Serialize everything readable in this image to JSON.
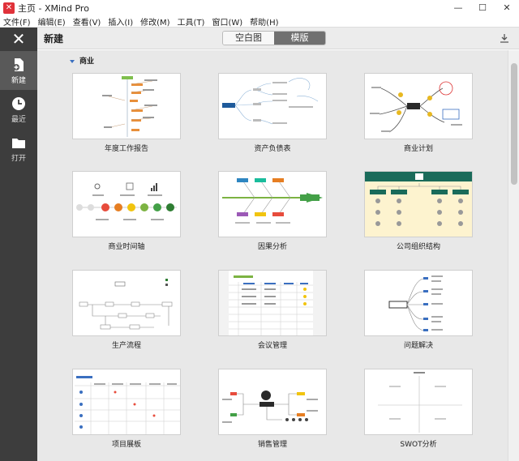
{
  "window": {
    "title": "主页 - XMind Pro",
    "minimize": "—",
    "maximize": "☐",
    "close": "✕"
  },
  "menu": [
    "文件(F)",
    "编辑(E)",
    "查看(V)",
    "插入(I)",
    "修改(M)",
    "工具(T)",
    "窗口(W)",
    "帮助(H)"
  ],
  "sidebar": {
    "items": [
      {
        "label": "新建",
        "icon": "new-file-icon"
      },
      {
        "label": "最近",
        "icon": "clock-icon"
      },
      {
        "label": "打开",
        "icon": "folder-icon"
      }
    ]
  },
  "toolbar": {
    "title": "新建",
    "tabs": [
      "空白图",
      "模版"
    ],
    "active_tab": "模版"
  },
  "section": {
    "title": "商业"
  },
  "templates": [
    {
      "label": "年度工作报告"
    },
    {
      "label": "资产负债表"
    },
    {
      "label": "商业计划"
    },
    {
      "label": "商业时间轴"
    },
    {
      "label": "因果分析"
    },
    {
      "label": "公司组织结构"
    },
    {
      "label": "生产流程"
    },
    {
      "label": "会议管理"
    },
    {
      "label": "问题解决"
    },
    {
      "label": "项目展板"
    },
    {
      "label": "销售管理"
    },
    {
      "label": "SWOT分析"
    }
  ],
  "colors": {
    "sidebar": "#3d3d3d",
    "accent": "#e0323a"
  }
}
